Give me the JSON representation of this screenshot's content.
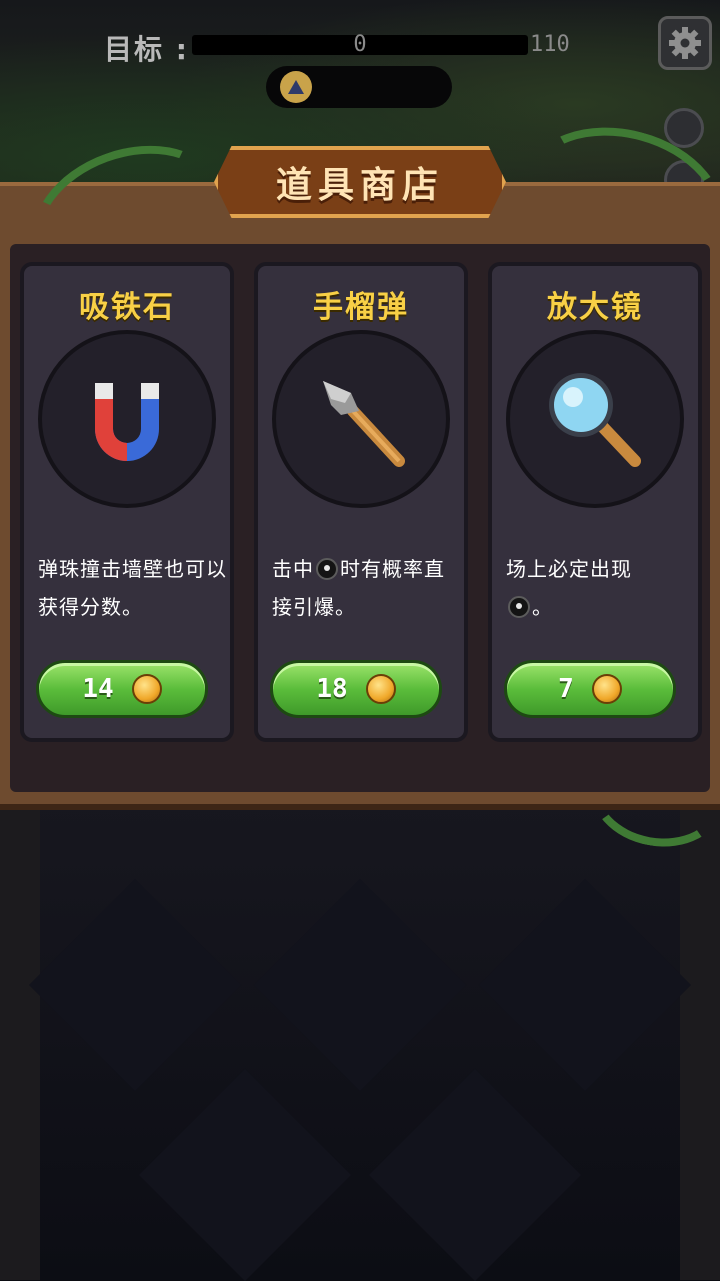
{
  "hud": {
    "goal_label": "目标 :",
    "score_current": "0",
    "score_target": "110",
    "progress_fraction": 0
  },
  "shop": {
    "title": "道具商店",
    "items": [
      {
        "name": "吸铁石",
        "desc_parts": [
          "弹珠撞击墙壁也可以获得分数。"
        ],
        "price": "14",
        "icon": "magnet-icon"
      },
      {
        "name": "手榴弹",
        "desc_parts": [
          "击中",
          "时有概率直接引爆。"
        ],
        "price": "18",
        "icon": "grenade-icon"
      },
      {
        "name": "放大镜",
        "desc_parts": [
          "场上必定出现",
          "。"
        ],
        "price": "7",
        "icon": "magnifier-icon"
      }
    ]
  },
  "colors": {
    "title_text": "#ffe4b5",
    "item_name": "#f8d046",
    "price_button": "#5bbd3b",
    "coin": "#f0a82a"
  }
}
